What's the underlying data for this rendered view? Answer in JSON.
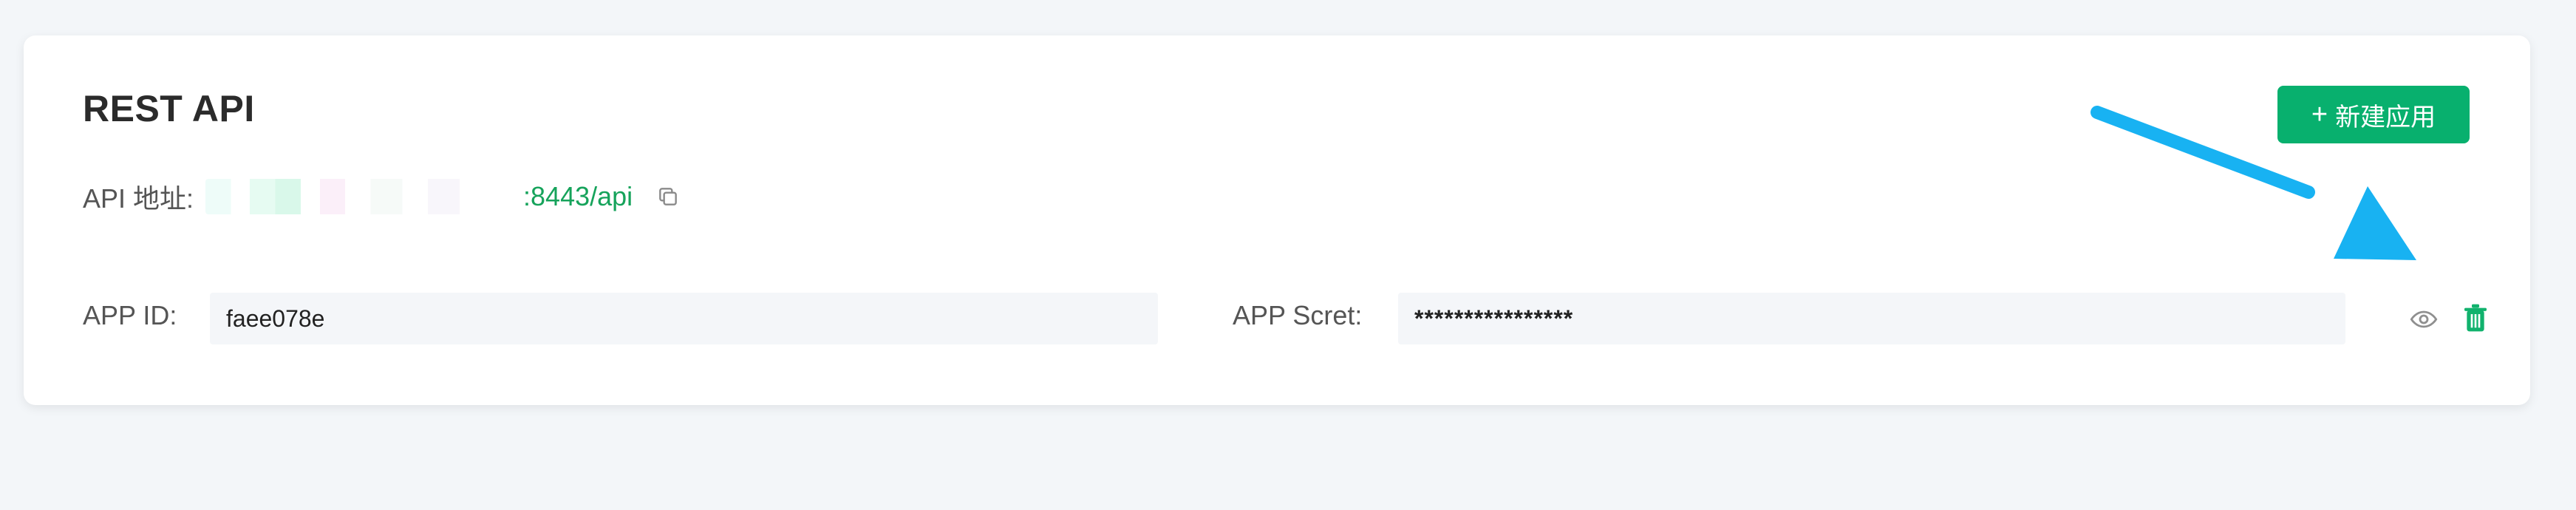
{
  "section": {
    "title": "REST API"
  },
  "actions": {
    "new_app_label": "新建应用",
    "new_app_plus": "+"
  },
  "api": {
    "label": "API 地址:",
    "value": ":8443/api"
  },
  "credentials": {
    "app_id_label": "APP ID:",
    "app_id_value": "faee078e",
    "app_secret_label": "APP Scret:",
    "app_secret_value": "****************"
  },
  "colors": {
    "primary": "#08b06e",
    "link": "#16a35b",
    "arrow": "#18b2f2"
  },
  "icons": {
    "copy": "copy-icon",
    "show_secret": "eye-icon",
    "delete": "trash-icon",
    "annotation": "arrow-icon"
  }
}
